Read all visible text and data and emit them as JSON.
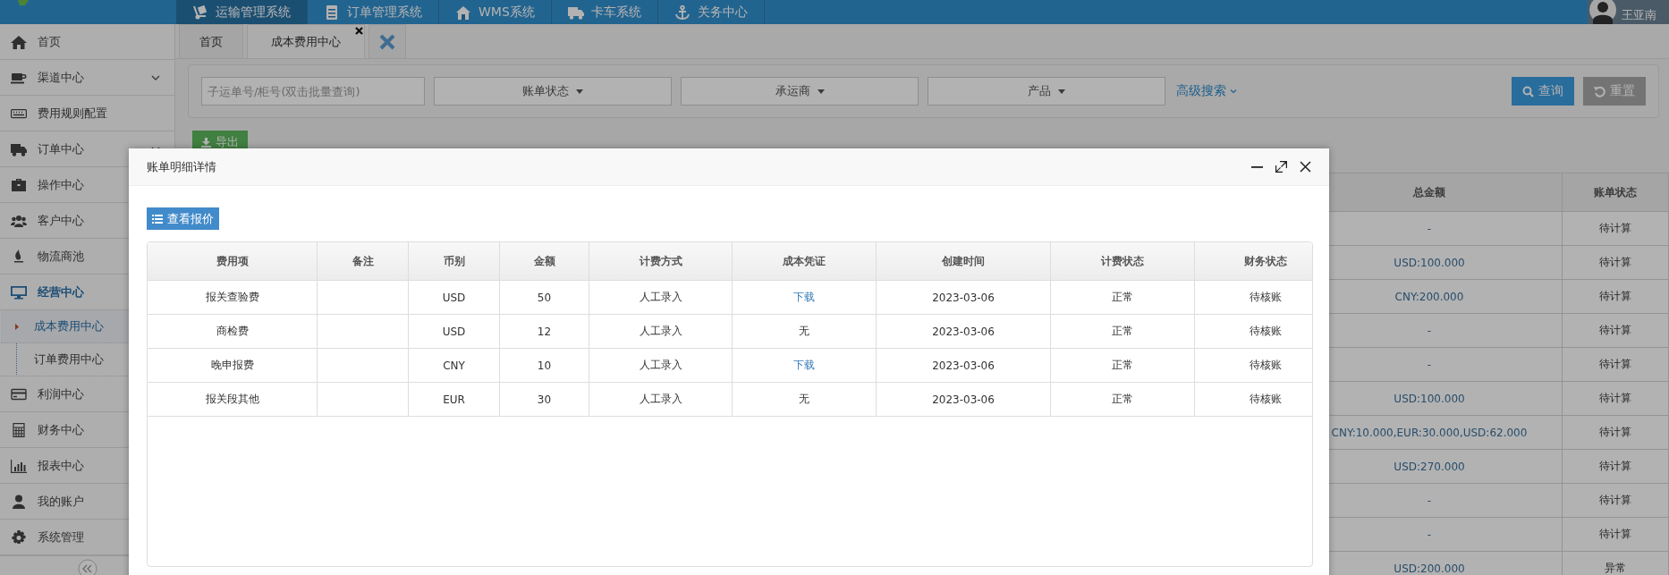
{
  "top_nav": {
    "items": [
      {
        "label": "运输管理系统",
        "selected": true
      },
      {
        "label": "订单管理系统",
        "selected": false
      },
      {
        "label": "WMS系统",
        "selected": false
      },
      {
        "label": "卡车系统",
        "selected": false
      },
      {
        "label": "关务中心",
        "selected": false
      }
    ],
    "user": {
      "name": "王亚南"
    }
  },
  "sidebar": {
    "items": [
      {
        "label": "首页",
        "selected": false,
        "collapsible": false
      },
      {
        "label": "渠道中心",
        "selected": false,
        "collapsible": true
      },
      {
        "label": "费用规则配置",
        "selected": false,
        "collapsible": false
      },
      {
        "label": "订单中心",
        "selected": false,
        "collapsible": true
      },
      {
        "label": "操作中心",
        "selected": false
      },
      {
        "label": "客户中心",
        "selected": false
      },
      {
        "label": "物流商池",
        "selected": false
      },
      {
        "label": "经营中心",
        "selected": true,
        "children": [
          {
            "label": "成本费用中心",
            "selected": true
          },
          {
            "label": "订单费用中心",
            "selected": false
          }
        ]
      },
      {
        "label": "利润中心",
        "selected": false
      },
      {
        "label": "财务中心",
        "selected": false
      },
      {
        "label": "报表中心",
        "selected": false
      },
      {
        "label": "我的账户",
        "selected": false
      },
      {
        "label": "系统管理",
        "selected": false
      }
    ]
  },
  "tabs": [
    {
      "label": "首页",
      "selected": false,
      "closable": false
    },
    {
      "label": "成本费用中心",
      "selected": true,
      "closable": true
    }
  ],
  "filters": {
    "search": {
      "placeholder": "子运单号/柜号(双击批量查询)"
    },
    "dropdowns": [
      "账单状态",
      "承运商",
      "产品"
    ],
    "advanced": "高级搜索",
    "buttons": [
      {
        "label": "查询",
        "kind": "primary"
      },
      {
        "label": "重置",
        "kind": "default"
      }
    ]
  },
  "export_button": "导出",
  "bill_table": {
    "columns": [
      "总金额",
      "账单状态"
    ],
    "rows": [
      {
        "total": "-",
        "status": "待计算"
      },
      {
        "total": "USD:100.000",
        "status": "待计算"
      },
      {
        "total": "CNY:200.000",
        "status": "待计算"
      },
      {
        "total": "-",
        "status": "待计算"
      },
      {
        "total": "-",
        "status": "待计算"
      },
      {
        "total": "USD:100.000",
        "status": "待计算"
      },
      {
        "total": "CNY:10.000,EUR:30.000,USD:62.000",
        "status": "待计算"
      },
      {
        "total": "USD:270.000",
        "status": "待计算"
      },
      {
        "total": "-",
        "status": "待计算"
      },
      {
        "total": "-",
        "status": "待计算"
      },
      {
        "total": "USD:200.000",
        "status": "异常"
      }
    ]
  },
  "modal": {
    "title": "账单明细详情",
    "quote_button": "查看报价",
    "columns": [
      "费用项",
      "备注",
      "币别",
      "金额",
      "计费方式",
      "成本凭证",
      "创建时间",
      "计费状态",
      "财务状态"
    ],
    "rows": [
      {
        "item": "报关查验费",
        "currency": "USD",
        "amount": "50",
        "method": "人工录入",
        "voucher": {
          "text": "下载",
          "link": true
        },
        "created": "2023-03-06",
        "billing_status": "正常",
        "finance_status": "待核账"
      },
      {
        "item": "商检费",
        "currency": "USD",
        "amount": "12",
        "method": "人工录入",
        "voucher": {
          "text": "无",
          "link": false
        },
        "created": "2023-03-06",
        "billing_status": "正常",
        "finance_status": "待核账"
      },
      {
        "item": "晚申报费",
        "currency": "CNY",
        "amount": "10",
        "method": "人工录入",
        "voucher": {
          "text": "下载",
          "link": true
        },
        "created": "2023-03-06",
        "billing_status": "正常",
        "finance_status": "待核账"
      },
      {
        "item": "报关段其他",
        "currency": "EUR",
        "amount": "30",
        "method": "人工录入",
        "voucher": {
          "text": "无",
          "link": false
        },
        "created": "2023-03-06",
        "billing_status": "正常",
        "finance_status": "待核账"
      }
    ]
  }
}
